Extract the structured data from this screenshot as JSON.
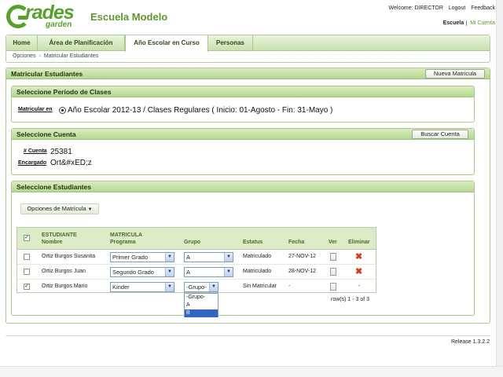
{
  "header": {
    "logo_main": "rades",
    "logo_sub": "garden",
    "school_name": "Escuela Modelo",
    "welcome": "Welcome: DIRECTOR",
    "logout": "Logout",
    "feedback": "Feedback",
    "escuela": "Escuela",
    "mi_cuenta": "Mi Cuenta"
  },
  "nav": {
    "tabs": [
      "Home",
      "Área de Planificación",
      "Año Escolar en Curso",
      "Personas"
    ],
    "active_tab": "Año Escolar en Curso",
    "breadcrumb": [
      "Opciones",
      "Matricular Estudiantes"
    ]
  },
  "main": {
    "title": "Matricular Estudiantes",
    "new_button": "Nueva Matricula"
  },
  "period": {
    "title": "Seleccione Periodo de Clases",
    "label": "Matricular en",
    "value": "Año Escolar 2012-13 / Clases Regulares ( Inicio: 01-Agosto - Fin: 31-Mayo )"
  },
  "account": {
    "title": "Seleccione Cuenta",
    "search_button": "Buscar Cuenta",
    "account_label": "# Cuenta",
    "account_value": "25381",
    "guardian_label": "Encargado",
    "guardian_value": "Ort&#xED;z"
  },
  "students": {
    "title": "Seleccione Estudiantes",
    "options_button": "Opciones de Matrícula",
    "headers": {
      "student_top": "ESTUDIANTE",
      "student_bottom": "Nombre",
      "enroll_top": "MATRICULA",
      "enroll_bottom": "Programa",
      "group": "Grupo",
      "status": "Estatus",
      "date": "Fecha",
      "view": "Ver",
      "delete": "Eliminar"
    },
    "rows": [
      {
        "name": "Ortiz Burgos Susanita",
        "program": "Primer Grado",
        "group": "A",
        "status": "Matriculado",
        "date": "27-NOV-12",
        "checked": false,
        "deletable": true
      },
      {
        "name": "Ortiz Burgos Juan",
        "program": "Segundo Grado",
        "group": "A",
        "status": "Matriculado",
        "date": "28-NOV-12",
        "checked": false,
        "deletable": true
      },
      {
        "name": "Ortiz Burgos Mario",
        "program": "Kinder",
        "group": "-Grupo-",
        "status": "Sin Matricular",
        "date": "-",
        "checked": true,
        "deletable": false,
        "delete_text": "-"
      }
    ],
    "group_options": [
      "-Grupo-",
      "A",
      "B"
    ],
    "highlighted_option": "B",
    "pagination": "row(s) 1 - 3 of 3"
  },
  "footer": {
    "release": "Release 1.3.2.2"
  },
  "colors": {
    "brand_green": "#55a32a",
    "header_green": "#b5d88f",
    "delete_red": "#d33b1a",
    "selection_blue": "#3166c4"
  }
}
